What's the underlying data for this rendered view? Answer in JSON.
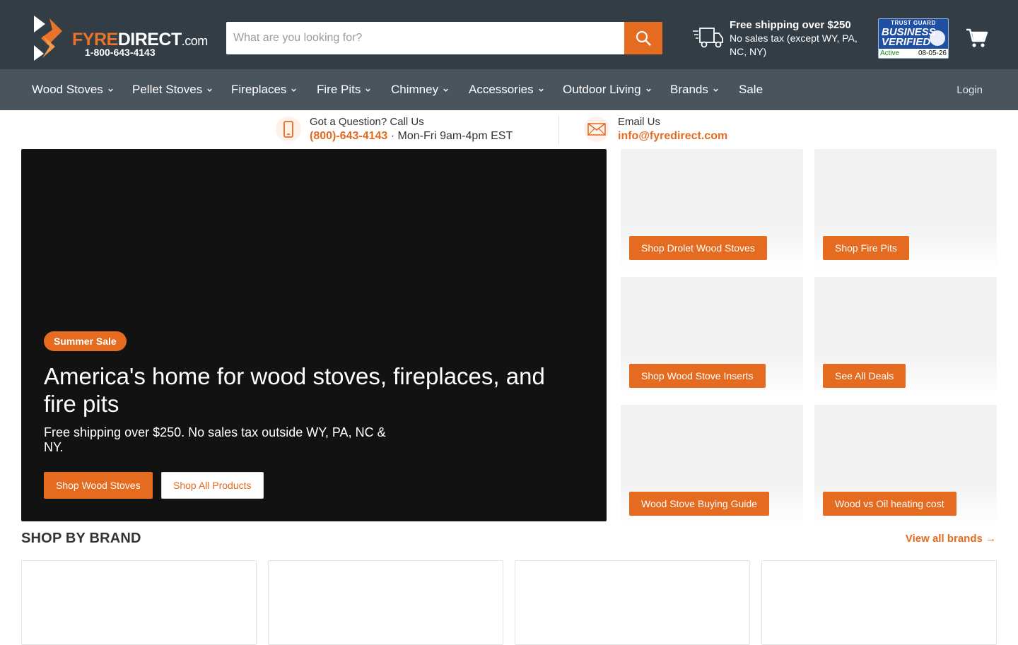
{
  "colors": {
    "accent": "#e46b1f",
    "header_bg": "#323d46",
    "nav_bg": "#4a545d",
    "hero_bg": "#121212"
  },
  "header": {
    "logo": {
      "word_a": "FYRE",
      "word_b": "DIRECT",
      "word_c": ".com",
      "phone": "1-800-643-4143"
    },
    "search": {
      "placeholder": "What are you looking for?",
      "value": "",
      "button_icon": "search-icon"
    },
    "shipping": {
      "title": "Free shipping over $250",
      "subtitle": "No sales tax (except WY, PA, NC, NY)",
      "icon": "truck-icon"
    },
    "trust_badge": {
      "top": "TRUST GUARD",
      "line1": "BUSINESS",
      "line2": "VERIFIED",
      "status": "Active",
      "date": "08-05-26"
    },
    "cart_icon": "cart-icon"
  },
  "nav": {
    "items": [
      {
        "label": "Wood Stoves",
        "has_dropdown": true
      },
      {
        "label": "Pellet Stoves",
        "has_dropdown": true
      },
      {
        "label": "Fireplaces",
        "has_dropdown": true
      },
      {
        "label": "Fire Pits",
        "has_dropdown": true
      },
      {
        "label": "Chimney",
        "has_dropdown": true
      },
      {
        "label": "Accessories",
        "has_dropdown": true
      },
      {
        "label": "Outdoor Living",
        "has_dropdown": true
      },
      {
        "label": "Brands",
        "has_dropdown": true
      },
      {
        "label": "Sale",
        "has_dropdown": false
      }
    ],
    "login": "Login"
  },
  "contact": {
    "call": {
      "label": "Got a Question? Call Us",
      "phone": "(800)-643-4143",
      "hours": " · Mon-Fri 9am-4pm EST",
      "icon": "phone-icon"
    },
    "email": {
      "label": "Email Us",
      "address": "info@fyredirect.com",
      "icon": "envelope-icon"
    }
  },
  "hero": {
    "badge": "Summer Sale",
    "heading": "America's home for wood stoves, fireplaces, and fire pits",
    "text": "Free shipping over $250. No sales tax outside WY, PA, NC & NY.",
    "primary_button": "Shop Wood Stoves",
    "secondary_button": "Shop All Products"
  },
  "promos": [
    {
      "label": "Shop Drolet Wood Stoves"
    },
    {
      "label": "Shop Fire Pits"
    },
    {
      "label": "Shop Wood Stove Inserts"
    },
    {
      "label": "See All Deals"
    },
    {
      "label": "Wood Stove Buying Guide"
    },
    {
      "label": "Wood vs Oil heating cost"
    }
  ],
  "brands_section": {
    "title": "SHOP BY BRAND",
    "view_all": "View all brands →",
    "card_count": 4
  }
}
